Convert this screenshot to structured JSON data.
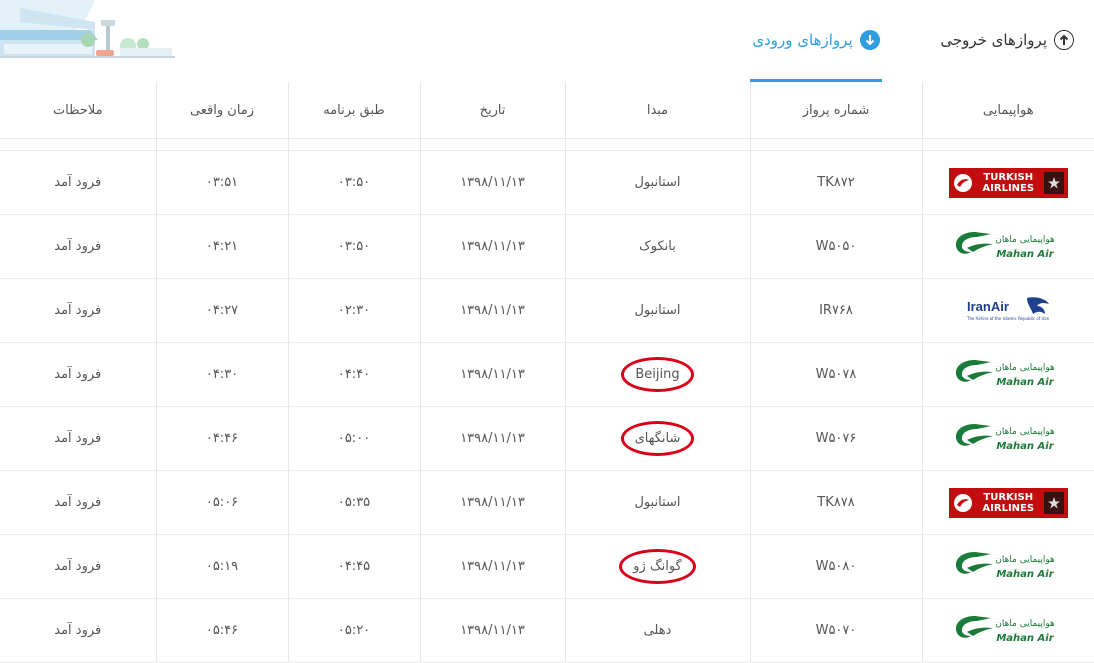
{
  "tabs": {
    "departures": "پروازهای خروجی",
    "arrivals": "پروازهای ورودی"
  },
  "columns": {
    "airline": "هواپیمایی",
    "flight_no": "شماره پرواز",
    "origin": "مبدا",
    "date": "تاریخ",
    "scheduled": "طبق برنامه",
    "actual": "زمان واقعی",
    "notes": "ملاحظات"
  },
  "logos": {
    "turkish_line1": "TURKISH",
    "turkish_line2": "AIRLINES",
    "mahan_fa": "هواپیمایی ماهان",
    "mahan_en": "Mahan Air",
    "iranair_en": "IranAir",
    "iranair_sub": "The Airline of the Islamic Republic of Iran"
  },
  "flights": [
    {
      "airline": "turkish",
      "flight": "TK۸۷۲",
      "origin": "استانبول",
      "date": "۱۳۹۸/۱۱/۱۳",
      "scheduled": "۰۳:۵۰",
      "actual": "۰۳:۵۱",
      "note": "فرود آمد",
      "circled": false
    },
    {
      "airline": "mahan",
      "flight": "W۵۰۵۰",
      "origin": "بانکوک",
      "date": "۱۳۹۸/۱۱/۱۳",
      "scheduled": "۰۳:۵۰",
      "actual": "۰۴:۲۱",
      "note": "فرود آمد",
      "circled": false
    },
    {
      "airline": "iranair",
      "flight": "IR۷۶۸",
      "origin": "استانبول",
      "date": "۱۳۹۸/۱۱/۱۳",
      "scheduled": "۰۲:۳۰",
      "actual": "۰۴:۲۷",
      "note": "فرود آمد",
      "circled": false
    },
    {
      "airline": "mahan",
      "flight": "W۵۰۷۸",
      "origin": "Beijing",
      "date": "۱۳۹۸/۱۱/۱۳",
      "scheduled": "۰۴:۴۰",
      "actual": "۰۴:۳۰",
      "note": "فرود آمد",
      "circled": true
    },
    {
      "airline": "mahan",
      "flight": "W۵۰۷۶",
      "origin": "شانگهای",
      "date": "۱۳۹۸/۱۱/۱۳",
      "scheduled": "۰۵:۰۰",
      "actual": "۰۴:۴۶",
      "note": "فرود آمد",
      "circled": true
    },
    {
      "airline": "turkish",
      "flight": "TK۸۷۸",
      "origin": "استانبول",
      "date": "۱۳۹۸/۱۱/۱۳",
      "scheduled": "۰۵:۳۵",
      "actual": "۰۵:۰۶",
      "note": "فرود آمد",
      "circled": false
    },
    {
      "airline": "mahan",
      "flight": "W۵۰۸۰",
      "origin": "گوانگ ژو",
      "date": "۱۳۹۸/۱۱/۱۳",
      "scheduled": "۰۴:۴۵",
      "actual": "۰۵:۱۹",
      "note": "فرود آمد",
      "circled": true
    },
    {
      "airline": "mahan",
      "flight": "W۵۰۷۰",
      "origin": "دهلی",
      "date": "۱۳۹۸/۱۱/۱۳",
      "scheduled": "۰۵:۲۰",
      "actual": "۰۵:۴۶",
      "note": "فرود آمد",
      "circled": false
    }
  ],
  "colors": {
    "accent": "#2f9ee0",
    "turkish_red": "#c20c0e",
    "mahan_green": "#1a7a3a",
    "iranair_blue": "#1f3f8f",
    "annotation_red": "#d90018"
  }
}
